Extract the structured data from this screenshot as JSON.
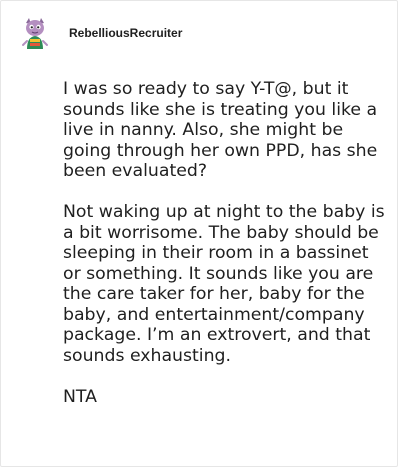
{
  "post": {
    "username": "RebelliousRecruiter",
    "avatar_icon": "cartoon-character-avatar-icon",
    "paragraphs": [
      "I was so ready to say Y-T@, but it sounds like she is treating you like a live in nanny. Also, she might be going through her own PPD, has she been evaluated?",
      "Not waking up at night to the baby is a bit worrisome. The baby should be sleeping in their room in a bassinet or something. It sounds like you are the care taker for her, baby for the baby, and entertainment/company package. I’m an extrovert, and that sounds exhausting.",
      "NTA"
    ]
  },
  "colors": {
    "text": "#1f1f1f",
    "border": "#e6e6e6",
    "background": "#ffffff"
  }
}
